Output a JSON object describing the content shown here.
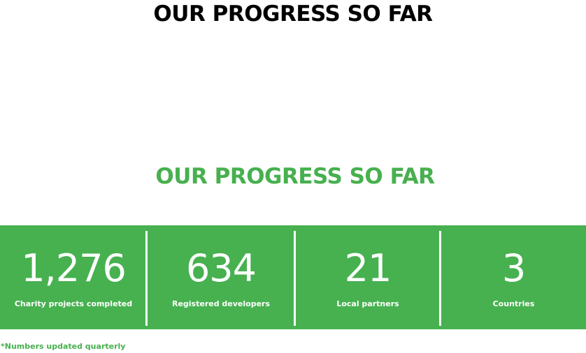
{
  "header": {
    "title_top": "OUR PROGRESS SO FAR",
    "title_green": "OUR PROGRESS SO FAR"
  },
  "stats": [
    {
      "value": "1,276",
      "label": "Charity projects completed"
    },
    {
      "value": "634",
      "label": "Registered developers"
    },
    {
      "value": "21",
      "label": "Local partners"
    },
    {
      "value": "3",
      "label": "Countries"
    }
  ],
  "footnote": "*Numbers updated quarterly",
  "colors": {
    "accent_green": "#47b150",
    "heading_black": "#000000",
    "text_white": "#ffffff"
  }
}
